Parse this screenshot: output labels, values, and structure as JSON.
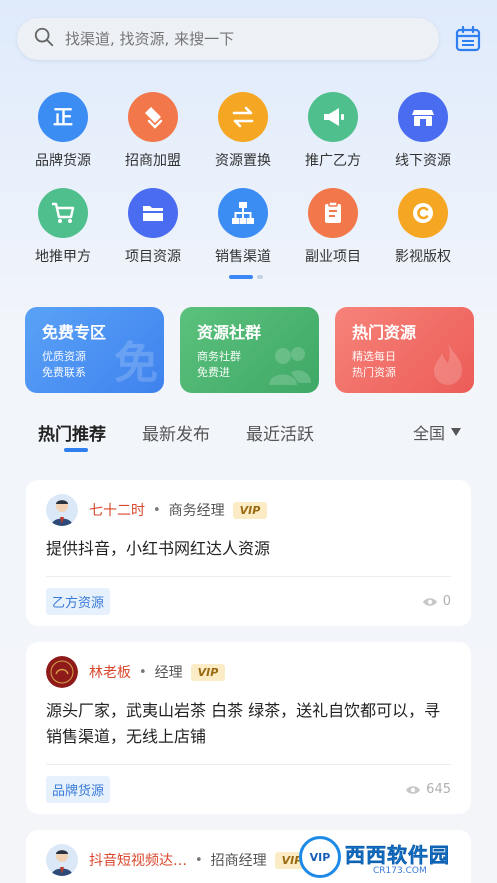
{
  "search": {
    "placeholder": "找渠道, 找资源, 来搜一下"
  },
  "grid": [
    {
      "label": "品牌货源",
      "color": "#3b8cf3",
      "icon": "zheng-icon"
    },
    {
      "label": "招商加盟",
      "color": "#f2784b",
      "icon": "handshake-icon"
    },
    {
      "label": "资源置换",
      "color": "#f5a623",
      "icon": "swap-icon"
    },
    {
      "label": "推广乙方",
      "color": "#4fc08d",
      "icon": "megaphone-icon"
    },
    {
      "label": "线下资源",
      "color": "#4a6cf0",
      "icon": "store-icon"
    },
    {
      "label": "地推甲方",
      "color": "#4fc08d",
      "icon": "cart-icon"
    },
    {
      "label": "项目资源",
      "color": "#4a6cf0",
      "icon": "folder-icon"
    },
    {
      "label": "销售渠道",
      "color": "#3b8cf3",
      "icon": "hierarchy-icon"
    },
    {
      "label": "副业项目",
      "color": "#f2784b",
      "icon": "clipboard-icon"
    },
    {
      "label": "影视版权",
      "color": "#f5a623",
      "icon": "copyright-icon"
    }
  ],
  "features": [
    {
      "title": "免费专区",
      "line1": "优质资源",
      "line2": "免费联系",
      "bg_glyph": "免",
      "color_from": "#5aa2f7",
      "color_to": "#3f82ee"
    },
    {
      "title": "资源社群",
      "line1": "商务社群",
      "line2": "免费进",
      "bg_glyph": "people-icon",
      "color_from": "#5bc27d",
      "color_to": "#3fa866"
    },
    {
      "title": "热门资源",
      "line1": "精选每日",
      "line2": "热门资源",
      "bg_glyph": "flame-icon",
      "color_from": "#f6837a",
      "color_to": "#ec5c57"
    }
  ],
  "tabs": [
    "热门推荐",
    "最新发布",
    "最近活跃"
  ],
  "region": "全国",
  "posts": [
    {
      "name": "七十二时",
      "role": "商务经理",
      "vip": "VIP",
      "text": "提供抖音，小红书网红达人资源",
      "tag": "乙方资源",
      "views": "0"
    },
    {
      "name": "林老板",
      "role": "经理",
      "vip": "VIP",
      "text": "源头厂家，武夷山岩茶 白茶 绿茶，送礼自饮都可以，寻销售渠道，无线上店铺",
      "tag": "品牌货源",
      "views": "645"
    },
    {
      "name": "抖音短视频达…",
      "role": "招商经理",
      "vip": "VIP"
    }
  ],
  "watermark": {
    "badge": "VIP",
    "main": "西西软件园",
    "sub": "CR173.COM"
  }
}
